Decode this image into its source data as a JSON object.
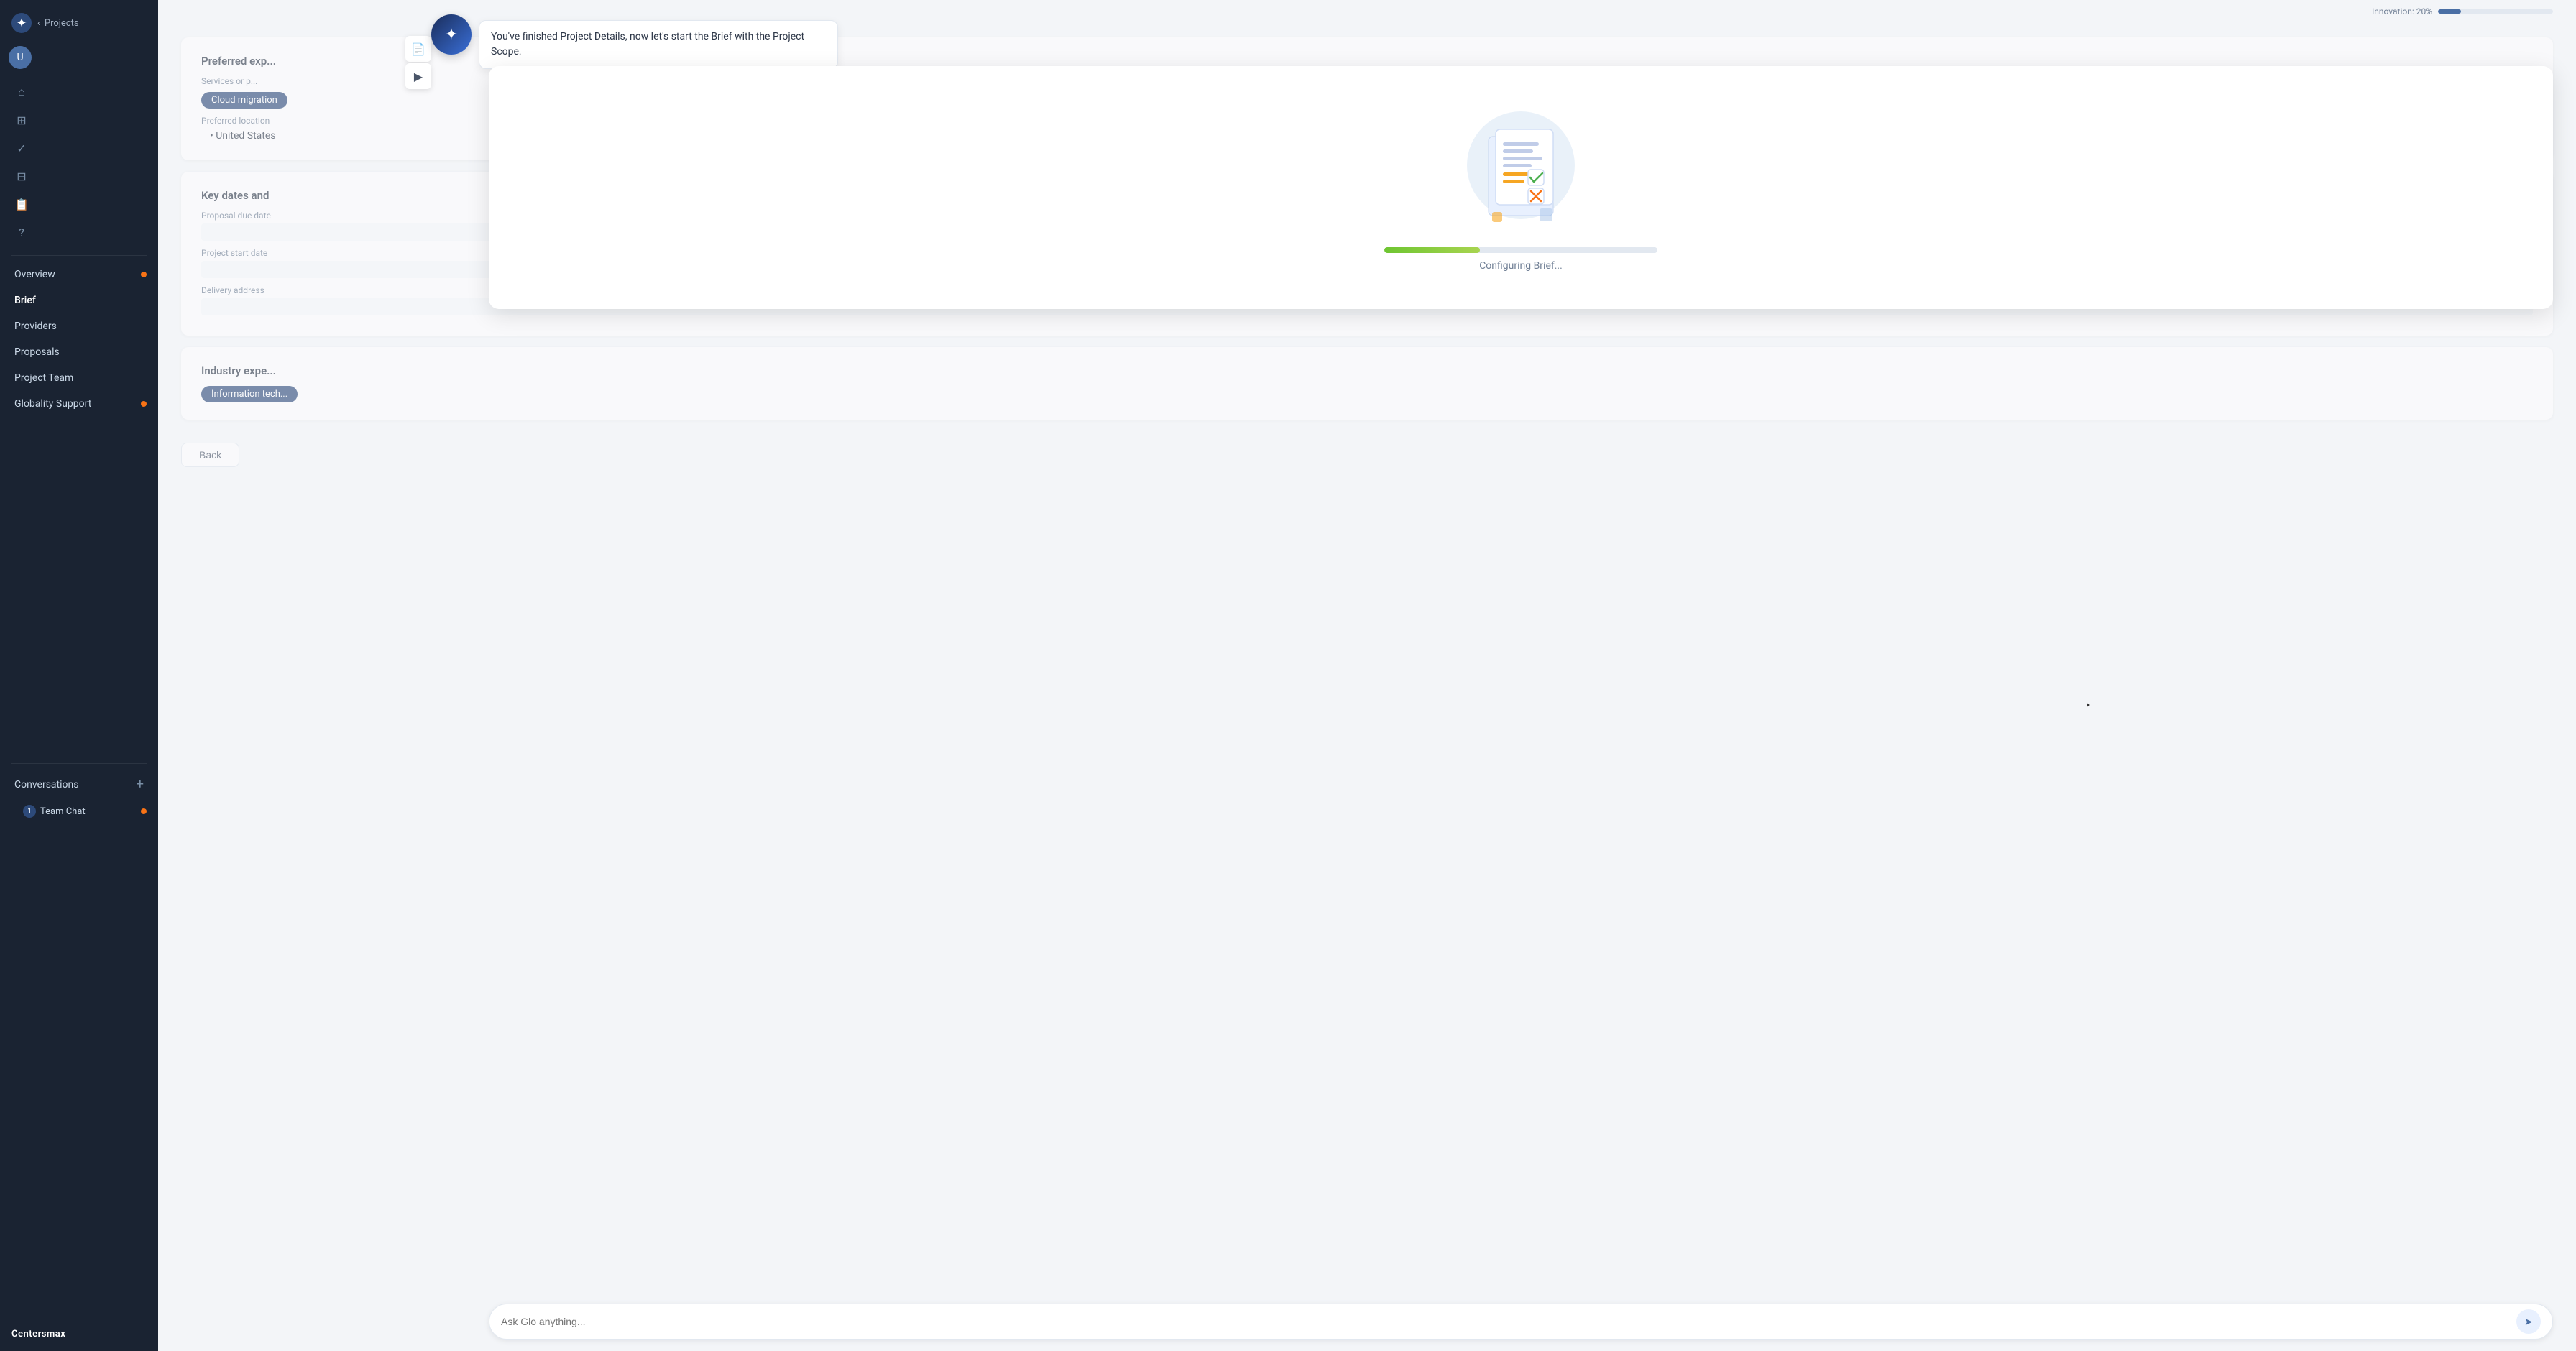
{
  "sidebar": {
    "logo_icon": "✦",
    "projects_label": "Projects",
    "chevron": "‹",
    "nav_items": [
      {
        "id": "overview",
        "label": "Overview",
        "has_dot": true
      },
      {
        "id": "brief",
        "label": "Brief",
        "has_dot": false
      },
      {
        "id": "providers",
        "label": "Providers",
        "has_dot": false
      },
      {
        "id": "proposals",
        "label": "Proposals",
        "has_dot": false
      },
      {
        "id": "project-team",
        "label": "Project Team",
        "has_dot": false
      },
      {
        "id": "globality-support",
        "label": "Globality Support",
        "has_dot": true
      }
    ],
    "conversations_label": "Conversations",
    "conversations_add": "+",
    "team_chat_label": "Team Chat",
    "team_chat_badge": "1",
    "team_chat_dot": true,
    "nav_icons": [
      {
        "id": "home",
        "icon": "⌂"
      },
      {
        "id": "grid",
        "icon": "⊞"
      },
      {
        "id": "check",
        "icon": "✓"
      },
      {
        "id": "apps",
        "icon": "⊟"
      },
      {
        "id": "docs",
        "icon": "📄"
      },
      {
        "id": "help",
        "icon": "?"
      }
    ]
  },
  "top_bar": {
    "innovation_label": "Innovation: 20%",
    "innovation_percent": 20
  },
  "bg_content": {
    "section1": {
      "title": "Preferred exp...",
      "services_label": "Services or p...",
      "cloud_tag": "Cloud migration",
      "location_label": "Preferred location",
      "location_value": "United States"
    },
    "section2": {
      "title": "Key dates and",
      "proposal_due_label": "Proposal due date",
      "project_start_label": "Project start date",
      "delivery_label": "Delivery address"
    },
    "section3": {
      "title": "Industry expe...",
      "info_tech_tag": "Information tech..."
    },
    "back_button": "Back"
  },
  "glo": {
    "avatar_icon": "✦",
    "tooltip": "You've finished Project Details, now let's start the Brief with the Project Scope.",
    "doc_icon": "📄",
    "collapse_icon": "▶"
  },
  "brief_config": {
    "status_label": "Configuring Brief...",
    "progress_percent": 35,
    "progress_width": "35%"
  },
  "ask_glo": {
    "placeholder": "Ask Glo anything...",
    "send_icon": "➤"
  }
}
